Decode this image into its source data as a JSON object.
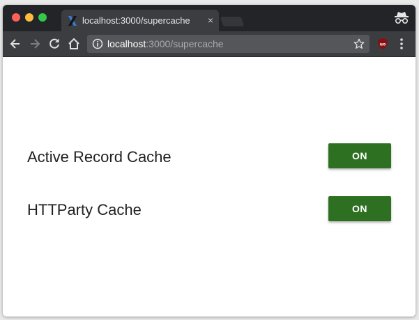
{
  "tab": {
    "title": "localhost:3000/supercache",
    "close": "×"
  },
  "address_bar": {
    "host": "localhost",
    "path": ":3000/supercache"
  },
  "settings": [
    {
      "label": "Active Record Cache",
      "button": "ON"
    },
    {
      "label": "HTTParty Cache",
      "button": "ON"
    }
  ],
  "colors": {
    "on_button": "#2e7022",
    "titlebar": "#232427",
    "toolbar": "#3c3d40"
  },
  "icons": [
    "close-window-icon",
    "minimize-window-icon",
    "maximize-window-icon",
    "favicon-icon",
    "incognito-icon",
    "back-icon",
    "forward-icon",
    "reload-icon",
    "home-icon",
    "info-icon",
    "star-icon",
    "ublock-icon",
    "menu-icon"
  ]
}
